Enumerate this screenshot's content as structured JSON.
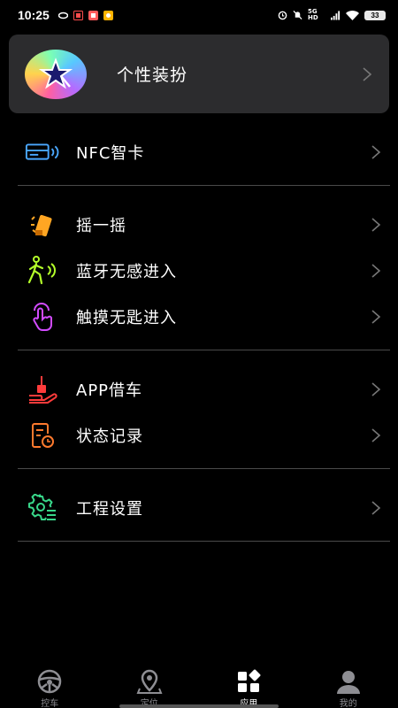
{
  "status_bar": {
    "time": "10:25",
    "network_label": "5G HD",
    "battery_level": "33"
  },
  "theme_card": {
    "label": "个性装扮",
    "icon": "magic-star-icon"
  },
  "menu": {
    "nfc": {
      "label": "NFC智卡",
      "icon": "nfc-card-icon",
      "color": "#4aa8ff"
    },
    "shake": {
      "label": "摇一摇",
      "icon": "shake-phone-icon",
      "color": "#ffa623"
    },
    "bluetooth": {
      "label": "蓝牙无感进入",
      "icon": "walking-bluetooth-icon",
      "color": "#b4ff2a"
    },
    "touch": {
      "label": "触摸无匙进入",
      "icon": "touch-finger-icon",
      "color": "#d24bff"
    },
    "app_borrow": {
      "label": "APP借车",
      "icon": "car-key-hand-icon",
      "color": "#ff3b3b"
    },
    "status_log": {
      "label": "状态记录",
      "icon": "record-clock-icon",
      "color": "#ff7a2e"
    },
    "engineering": {
      "label": "工程设置",
      "icon": "gear-list-icon",
      "color": "#38d78a"
    }
  },
  "tabs": [
    {
      "label": "控车",
      "icon": "steering-wheel-icon",
      "active": false
    },
    {
      "label": "定位",
      "icon": "location-pin-icon",
      "active": false
    },
    {
      "label": "应用",
      "icon": "apps-grid-icon",
      "active": true
    },
    {
      "label": "我的",
      "icon": "user-profile-icon",
      "active": false
    }
  ]
}
